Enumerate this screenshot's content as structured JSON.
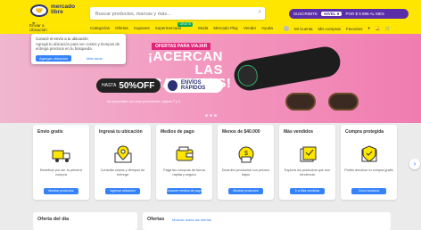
{
  "header": {
    "logo_text": "mercado libre",
    "search_placeholder": "Buscar productos, marcas y más…",
    "promo": {
      "prefix": "SUSCRIBITE",
      "badge": "NIVEL 6",
      "suffix": "POR $ 9.999 AL MES"
    },
    "location": {
      "line1": "Enviar a",
      "line2": "Ubicación"
    },
    "nav": [
      "Categorías",
      "Ofertas",
      "Cupones",
      "Supermercado",
      "Moda",
      "Mercado Play",
      "Vender",
      "Ayuda"
    ],
    "nav_badge": "GRATIS",
    "user_nav": [
      "Mi Cuenta",
      "Mis compras",
      "Favoritos"
    ]
  },
  "popup": {
    "title": "Conocé el envío a tu ubicación",
    "desc": "Agregá tu ubicación para ver costos y tiempos de entrega precisos en tu búsqueda.",
    "primary": "Agregar ubicación",
    "secondary": "Más tarde"
  },
  "banner": {
    "tag": "OFERTAS PARA VIAJAR",
    "headline": "¡ACERCAN LAS VACACIONES!",
    "off_prefix": "HASTA",
    "off_value": "50%OFF",
    "shipping": "ENVÍOS RÁPIDOS",
    "legal": "No acumulable con otras promociones. Aplican T y C."
  },
  "cards": [
    {
      "title": "Envío gratis",
      "desc": "Beneficio por ser tu primera compra",
      "button": "Mostrar productos",
      "icon": "truck-icon"
    },
    {
      "title": "Ingresá tu ubicación",
      "desc": "Consulta costos y tiempos de entrega",
      "button": "Ingresar ubicación",
      "icon": "location-pin-icon"
    },
    {
      "title": "Medios de pago",
      "desc": "Pagá tus compras de forma rápida y segura",
      "button": "Conocer medios de pago",
      "icon": "wallet-icon"
    },
    {
      "title": "Menos de $40.000",
      "desc": "Descubrí productos con precios bajos",
      "button": "Mostrar productos",
      "icon": "price-tag-icon"
    },
    {
      "title": "Más vendidos",
      "desc": "Explorá los productos que son tendencia",
      "button": "Ir a Más vendidos",
      "icon": "bestseller-icon"
    },
    {
      "title": "Compra protegida",
      "desc": "Podés devolver tu compra gratis",
      "button": "Cómo funciona",
      "icon": "shield-icon"
    }
  ],
  "bottom": {
    "deal_title": "Oferta del día",
    "offers_title": "Ofertas",
    "offers_link": "Mostrar todas las ofertas"
  },
  "colors": {
    "brand_yellow": "#ffe600",
    "accent_blue": "#3483fa",
    "navy": "#2d3277"
  }
}
